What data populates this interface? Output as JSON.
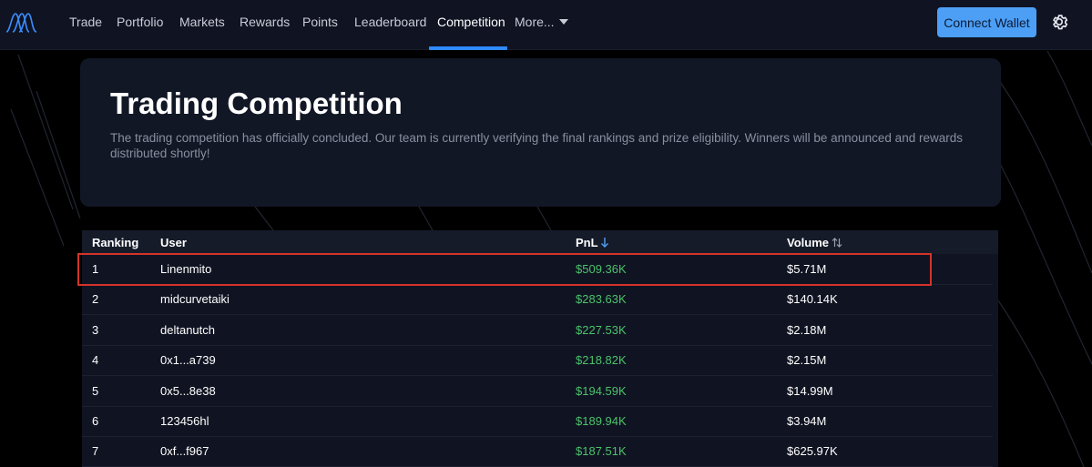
{
  "nav": {
    "items": [
      "Trade",
      "Portfolio",
      "Markets",
      "Rewards",
      "Points",
      "Leaderboard",
      "Competition",
      "More..."
    ],
    "active": "Competition",
    "connect_label": "Connect Wallet"
  },
  "hero": {
    "title": "Trading Competition",
    "description": "The trading competition has officially concluded. Our team is currently verifying the final rankings and prize eligibility. Winners will be announced and rewards distributed shortly!"
  },
  "table": {
    "headers": {
      "ranking": "Ranking",
      "user": "User",
      "pnl": "PnL",
      "volume": "Volume"
    },
    "rows": [
      {
        "rank": "1",
        "user": "Linenmito",
        "pnl": "$509.36K",
        "volume": "$5.71M"
      },
      {
        "rank": "2",
        "user": "midcurvetaiki",
        "pnl": "$283.63K",
        "volume": "$140.14K"
      },
      {
        "rank": "3",
        "user": "deltanutch",
        "pnl": "$227.53K",
        "volume": "$2.18M"
      },
      {
        "rank": "4",
        "user": "0x1...a739",
        "pnl": "$218.82K",
        "volume": "$2.15M"
      },
      {
        "rank": "5",
        "user": "0x5...8e38",
        "pnl": "$194.59K",
        "volume": "$14.99M"
      },
      {
        "rank": "6",
        "user": "123456hl",
        "pnl": "$189.94K",
        "volume": "$3.94M"
      },
      {
        "rank": "7",
        "user": "0xf...f967",
        "pnl": "$187.51K",
        "volume": "$625.97K"
      }
    ]
  },
  "colors": {
    "accent": "#2f8bff",
    "button": "#4c9ff5",
    "pnl_positive": "#4bc26a",
    "highlight": "#d4332a"
  },
  "icons": {
    "logo": "logo-icon",
    "more": "chevron-down-icon",
    "settings": "gear-icon",
    "pnl_sort": "arrow-down-icon",
    "volume_sort": "sort-updown-icon"
  }
}
